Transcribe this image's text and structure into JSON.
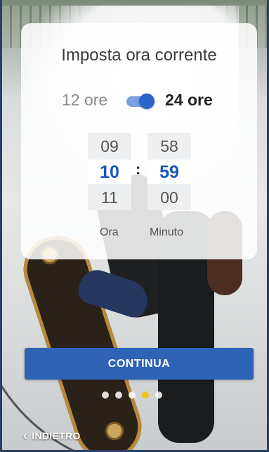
{
  "dialog": {
    "title": "Imposta ora corrente",
    "format_12_label": "12 ore",
    "format_24_label": "24 ore",
    "format_24_enabled": true
  },
  "time_picker": {
    "hours": {
      "prev": "09",
      "selected": "10",
      "next": "11",
      "label": "Ora"
    },
    "separator": ":",
    "minutes": {
      "prev": "58",
      "selected": "59",
      "next": "00",
      "label": "Minuto"
    }
  },
  "actions": {
    "continue_label": "CONTINUA",
    "back_label": "INDIETRO"
  },
  "pagination": {
    "total": 5,
    "active_index": 3
  },
  "colors": {
    "accent": "#2e63b5",
    "selected_value": "#1b56b8",
    "active_dot": "#f0c419"
  }
}
